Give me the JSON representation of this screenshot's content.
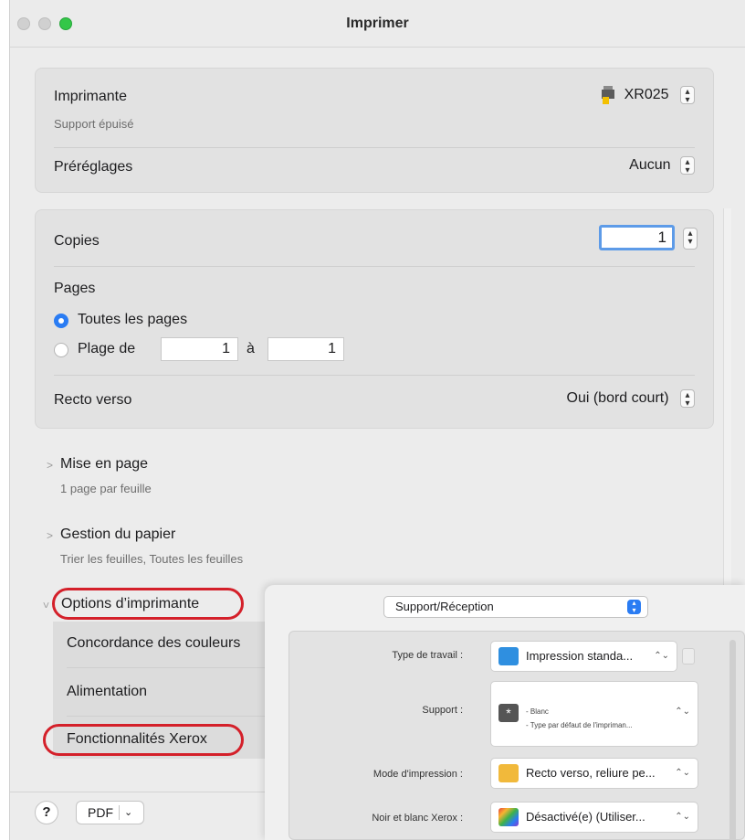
{
  "window": {
    "title": "Imprimer"
  },
  "printer": {
    "label": "Imprimante",
    "status": "Support épuisé",
    "value": "XR025"
  },
  "presets": {
    "label": "Préréglages",
    "value": "Aucun"
  },
  "copies": {
    "label": "Copies",
    "value": "1"
  },
  "pages": {
    "label": "Pages",
    "all_label": "Toutes les pages",
    "range_label": "Plage de",
    "range_from": "1",
    "range_sep": "à",
    "range_to": "1"
  },
  "duplex": {
    "label": "Recto verso",
    "value": "Oui (bord court)"
  },
  "sections": {
    "layout": {
      "title": "Mise en page",
      "summary": "1 page par feuille"
    },
    "paper": {
      "title": "Gestion du papier",
      "summary": "Trier les feuilles, Toutes les feuilles"
    },
    "printer_options": {
      "title": "Options d’imprimante"
    }
  },
  "printer_options_items": {
    "color_matching": "Concordance des couleurs",
    "paper_feed": "Alimentation",
    "xerox_features": "Fonctionnalités Xerox"
  },
  "footer": {
    "help": "?",
    "pdf": "PDF",
    "pdf_menu": "⌄"
  },
  "xerox_panel": {
    "selector": "Support/Réception",
    "rows": {
      "job_type": {
        "label": "Type de travail :",
        "value": "Impression standa..."
      },
      "paper": {
        "label": "Support :",
        "line1": "- Blanc",
        "line2": "- Type par défaut de l'impriman..."
      },
      "print_mode": {
        "label": "Mode d'impression :",
        "value": "Recto verso, reliure pe..."
      },
      "bw": {
        "label": "Noir et blanc Xerox :",
        "value": "Désactivé(e) (Utiliser..."
      }
    }
  },
  "colors": {
    "accent": "#2a7cf3",
    "highlight_oval": "#d4202a",
    "focus_ring": "#5d9be8"
  },
  "icons": {
    "printer": "printer-icon",
    "disclosure": "chevron-right-icon",
    "stepper": "up-down-arrows-icon"
  }
}
